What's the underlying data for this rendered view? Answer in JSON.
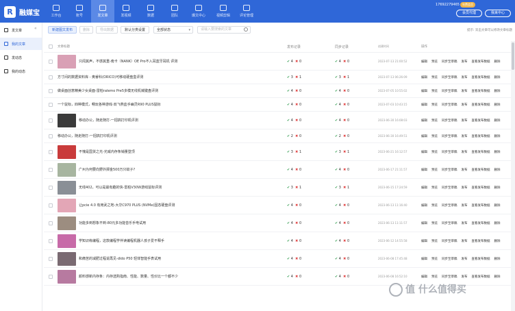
{
  "app": {
    "logo_text": "融媒宝"
  },
  "nav": [
    {
      "label": "工作台"
    },
    {
      "label": "账号"
    },
    {
      "label": "发文章"
    },
    {
      "label": "发视频"
    },
    {
      "label": "数据"
    },
    {
      "label": "团队"
    },
    {
      "label": "爆文中心"
    },
    {
      "label": "视频剪辑"
    },
    {
      "label": "评论管理"
    }
  ],
  "user": {
    "phone": "17692279465",
    "vip_badge": "年费会员",
    "buy_vip": "会员代理",
    "account_btn": "我来中心"
  },
  "sidebar": {
    "items": [
      {
        "label": "发文章"
      },
      {
        "label": "我的文章"
      },
      {
        "label": "发动态"
      },
      {
        "label": "我的动态"
      }
    ]
  },
  "toolbar": {
    "new_btn": "新建图文发布",
    "delete_btn": "删除",
    "export_btn": "导出数据",
    "default_cat": "默认分类设置",
    "status_select": "全部状态",
    "search_placeholder": "请输入要搜索的文章",
    "tip": "提示: 双击文章可以修改文章标题"
  },
  "columns": {
    "title": "文章标题",
    "publish": "发布记录",
    "sync": "同步记录",
    "created": "创建时间",
    "ops": "操作"
  },
  "ops": {
    "edit": "编辑",
    "preview": "预览",
    "sync_draft": "同步至草稿",
    "publish": "发布",
    "data": "查看发布数据",
    "delete": "删除"
  },
  "rows": [
    {
      "title": "只闻其声，不感其重-南卡（NANK）OE Pro不入耳蓝牙耳机 评测",
      "pub_ok": "4",
      "pub_fail": "0",
      "sync_ok": "4",
      "sync_fail": "0",
      "time": "2023-07-13 21:00:52",
      "thumb": "#d9a0b5"
    },
    {
      "title": "方寸间的数据资料库 - 奥睿科(ORICO)可移动硬盘盒评测",
      "pub_ok": "3",
      "pub_fail": "1",
      "sync_ok": "3",
      "sync_fail": "1",
      "time": "2023-07-13 06:26:09",
      "thumb": ""
    },
    {
      "title": "做桌面创意精美少女桌面-雷柏ralemo Pre5多模无线机械键盘评测",
      "pub_ok": "4",
      "pub_fail": "0",
      "sync_ok": "4",
      "sync_fail": "0",
      "time": "2023-07-05 10:55:02",
      "thumb": ""
    },
    {
      "title": "一个鼠标，四种模式，畅玩各种游戏-双飞燕血手幽灵R90 PLUS鼠标",
      "pub_ok": "4",
      "pub_fail": "0",
      "sync_ok": "4",
      "sync_fail": "0",
      "time": "2023-07-03 10:43:15",
      "thumb": ""
    },
    {
      "title": "移动办公，随走随打-一招搞打印机评测",
      "pub_ok": "4",
      "pub_fail": "0",
      "sync_ok": "4",
      "sync_fail": "0",
      "time": "2023-06-30 16:08:03",
      "thumb": "#3a3a3a"
    },
    {
      "title": "移动办公，随走随打-一招搞打印机评测",
      "pub_ok": "2",
      "pub_fail": "0",
      "sync_ok": "2",
      "sync_fail": "0",
      "time": "2023-06-30 16:49:51",
      "thumb": ""
    },
    {
      "title": "不愧是国货之光-光威内存条销量登顶",
      "pub_ok": "3",
      "pub_fail": "1",
      "sync_ok": "3",
      "sync_fail": "1",
      "time": "2023-06-21 16:12:57",
      "thumb": "#c93b3b"
    },
    {
      "title": "广州为何要向野外掷金500万只蚊子?",
      "pub_ok": "4",
      "pub_fail": "0",
      "sync_ok": "4",
      "sync_fail": "0",
      "time": "2023-06-17 21:11:57",
      "thumb": "#a7b5a0"
    },
    {
      "title": "无线402，可以是最有趣的快-雷柏V30W游戏鼠标评测",
      "pub_ok": "3",
      "pub_fail": "1",
      "sync_ok": "3",
      "sync_fail": "1",
      "time": "2023-06-15 17:24:59",
      "thumb": "#8a8f96"
    },
    {
      "title": "让pcie 4.0 有用武之地-大华C970 PLUS (NVMe)固态硬盘评测",
      "pub_ok": "4",
      "pub_fail": "0",
      "sync_ok": "4",
      "sync_fail": "0",
      "time": "2023-06-13 11:16:40",
      "thumb": "#e3a6b6"
    },
    {
      "title": "功能多到想象不到-80元多功能音乐手电试用",
      "pub_ok": "4",
      "pub_fail": "0",
      "sync_ok": "4",
      "sync_fail": "0",
      "time": "2023-06-13 11:11:57",
      "thumb": "#9c8d80"
    },
    {
      "title": "学知识练编程，这款编程学伴读编程机器人孩子爱不释手",
      "pub_ok": "4",
      "pub_fail": "0",
      "sync_ok": "4",
      "sync_fail": "0",
      "time": "2023-06-12 14:55:58",
      "thumb": "#c76aa8"
    },
    {
      "title": "和痛苦的减肥过程说再见-dido P50 轻体智能手表试用",
      "pub_ok": "4",
      "pub_fail": "0",
      "sync_ok": "4",
      "sync_fail": "0",
      "time": "2023-06-08 17:45:48",
      "thumb": "#7a6a72"
    },
    {
      "title": "颜料感新内存条：内存选购指南、性能、数量、性价比一个都不少",
      "pub_ok": "4",
      "pub_fail": "0",
      "sync_ok": "4",
      "sync_fail": "0",
      "time": "2023-06-08 16:52:10",
      "thumb": "#b77aa0"
    }
  ],
  "watermark": "值 什么值得买"
}
